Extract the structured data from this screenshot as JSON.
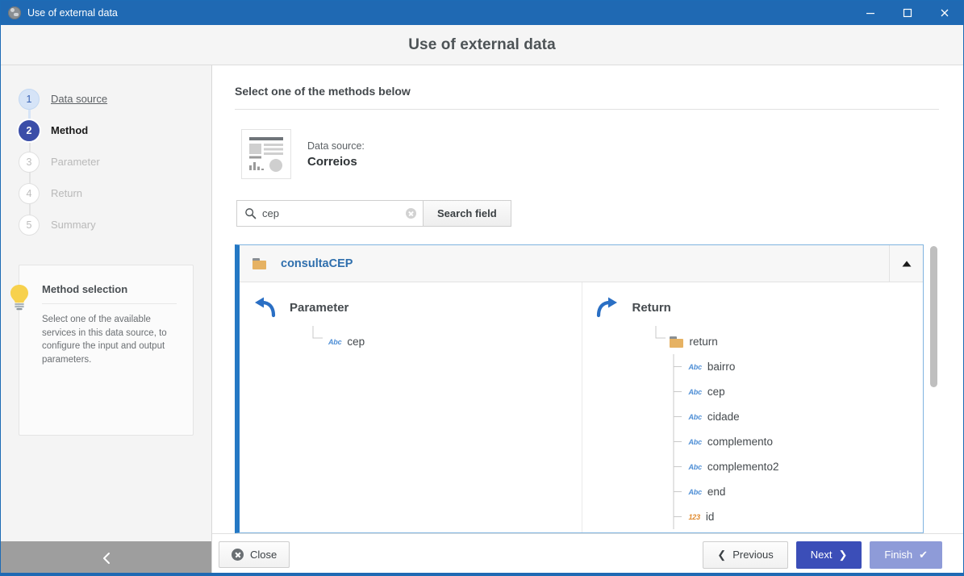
{
  "window": {
    "title": "Use of external data",
    "icon": "globe-icon",
    "controls": {
      "minimize": "minimize-icon",
      "maximize": "maximize-icon",
      "close": "close-icon"
    }
  },
  "header": {
    "title": "Use of external data"
  },
  "sidebar": {
    "steps": [
      {
        "number": "1",
        "label": "Data source",
        "state": "done"
      },
      {
        "number": "2",
        "label": "Method",
        "state": "current"
      },
      {
        "number": "3",
        "label": "Parameter",
        "state": "todo"
      },
      {
        "number": "4",
        "label": "Return",
        "state": "todo"
      },
      {
        "number": "5",
        "label": "Summary",
        "state": "todo"
      }
    ],
    "help": {
      "icon": "lightbulb-icon",
      "title": "Method selection",
      "text": "Select one of the available services in this data source, to configure the input and output parameters."
    },
    "collapse": {
      "icon": "chevron-left-icon"
    }
  },
  "main": {
    "title": "Select one of the methods below",
    "data_source": {
      "icon": "report-document-icon",
      "label": "Data source:",
      "value": "Correios"
    },
    "search": {
      "icon": "search-icon",
      "value": "cep",
      "placeholder": "",
      "clear_icon": "clear-circle-icon",
      "button_label": "Search field"
    },
    "method_panel": {
      "folder_icon": "folder-icon",
      "name": "consultaCEP",
      "collapse_icon": "triangle-up-icon",
      "parameter": {
        "icon": "arrow-in-icon",
        "title": "Parameter",
        "nodes": [
          {
            "type": "Abc",
            "type_kind": "text",
            "label": "cep",
            "indent": 1
          }
        ]
      },
      "return": {
        "icon": "arrow-out-icon",
        "title": "Return",
        "nodes": [
          {
            "type": "folder",
            "type_kind": "folder",
            "label": "return",
            "indent": 1
          },
          {
            "type": "Abc",
            "type_kind": "text",
            "label": "bairro",
            "indent": 2
          },
          {
            "type": "Abc",
            "type_kind": "text",
            "label": "cep",
            "indent": 2
          },
          {
            "type": "Abc",
            "type_kind": "text",
            "label": "cidade",
            "indent": 2
          },
          {
            "type": "Abc",
            "type_kind": "text",
            "label": "complemento",
            "indent": 2
          },
          {
            "type": "Abc",
            "type_kind": "text",
            "label": "complemento2",
            "indent": 2
          },
          {
            "type": "Abc",
            "type_kind": "text",
            "label": "end",
            "indent": 2
          },
          {
            "type": "123",
            "type_kind": "number",
            "label": "id",
            "indent": 2
          }
        ]
      }
    }
  },
  "footer": {
    "close_label": "Close",
    "close_icon": "close-circle-icon",
    "previous_label": "Previous",
    "previous_icon": "chevron-left-icon",
    "next_label": "Next",
    "next_icon": "chevron-right-icon",
    "finish_label": "Finish",
    "finish_icon": "check-icon"
  },
  "colors": {
    "titlebar": "#1f69b3",
    "accent": "#2478c4",
    "current_step": "#3b4ea8",
    "next_button": "#3b4eb8",
    "finish_button": "#8e9bd8",
    "folder": "#e6b263",
    "type_text": "#4f8fd6",
    "type_number": "#e08a2e",
    "method_title": "#2f6fad"
  }
}
